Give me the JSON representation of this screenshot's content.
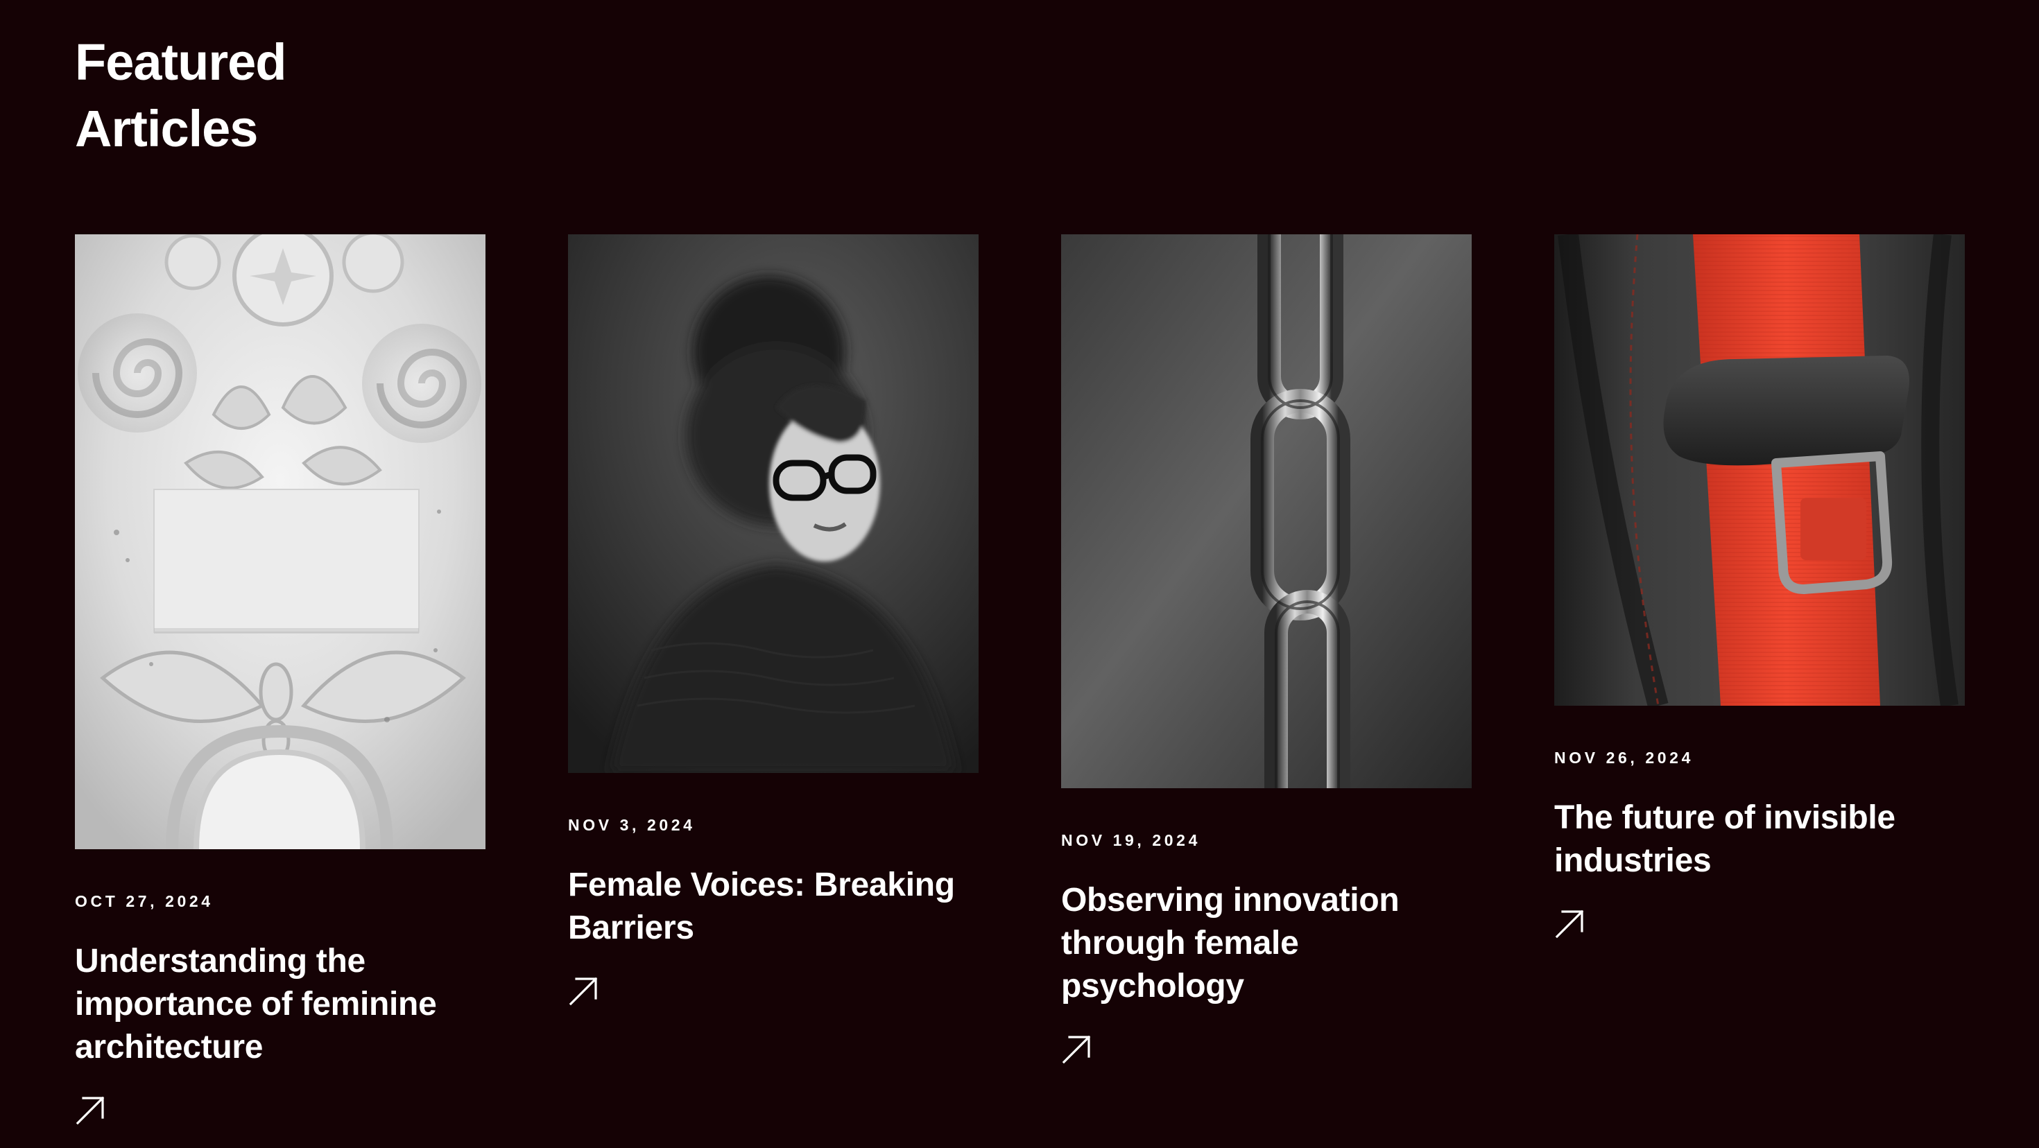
{
  "section": {
    "title_lines": [
      "Featured",
      "Articles"
    ]
  },
  "colors": {
    "background": "#150205",
    "text": "#ffffff",
    "seatbelt_red": "#e8402c"
  },
  "articles": [
    {
      "date": "OCT 27, 2024",
      "title_lines": [
        "Understanding the",
        "importance of feminine",
        "architecture"
      ],
      "image": "ornamental-plaster-capital-with-blank-card",
      "icon": "arrow-up-right-icon"
    },
    {
      "date": "NOV 3, 2024",
      "title_lines": [
        "Female Voices: Breaking",
        "Barriers"
      ],
      "image": "blurred-portrait-woman-with-glasses",
      "icon": "arrow-up-right-icon"
    },
    {
      "date": "NOV 19, 2024",
      "title_lines": [
        "Observing innovation",
        "through female",
        "psychology"
      ],
      "image": "hanging-steel-chain",
      "icon": "arrow-up-right-icon"
    },
    {
      "date": "NOV 26, 2024",
      "title_lines": [
        "The future of invisible",
        "industries"
      ],
      "image": "red-seatbelt-buckle-on-leather-seat",
      "icon": "arrow-up-right-icon"
    }
  ]
}
